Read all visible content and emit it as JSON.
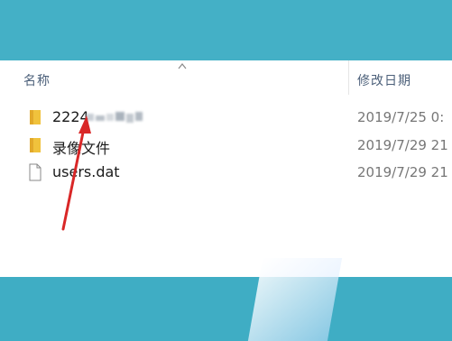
{
  "column_headers": {
    "name": "名称",
    "date_modified": "修改日期"
  },
  "files": [
    {
      "name": "2224",
      "date": "2019/7/25 0:",
      "type": "folder",
      "icon": "folder-icon",
      "name_partially_pixelated": true
    },
    {
      "name": "录像文件",
      "date": "2019/7/29 21",
      "type": "folder",
      "icon": "folder-icon"
    },
    {
      "name": "users.dat",
      "date": "2019/7/29 21",
      "type": "file",
      "icon": "document-icon"
    }
  ],
  "colors": {
    "background_band": "#44b0c6",
    "header_text": "#4c607a",
    "folder": "#f0c23c",
    "arrow": "#d92727"
  }
}
